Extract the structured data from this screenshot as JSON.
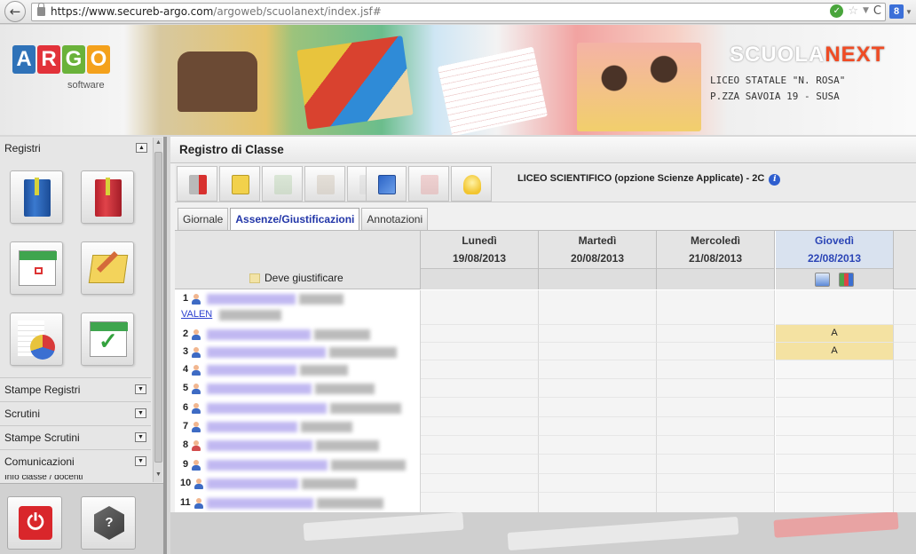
{
  "browser": {
    "url_main": "https://www.secureb-argo.com",
    "url_rest": "/argoweb/scuolanext/index.jsf#",
    "search_engine": "8"
  },
  "banner": {
    "logo_letters": [
      "A",
      "R",
      "G",
      "O"
    ],
    "logo_sub": "software",
    "product_name_a": "SCUOLA",
    "product_name_b": "NEXT",
    "school_name": "LICEO STATALE \"N. ROSA\"",
    "school_address": "P.ZZA SAVOIA 19 - SUSA"
  },
  "sidebar": {
    "section_title": "Registri",
    "tiles": [
      {
        "name": "registro-classe",
        "icon": "blue-book-icon"
      },
      {
        "name": "registro-professore",
        "icon": "red-book-icon"
      },
      {
        "name": "calendario",
        "icon": "calendar-icon"
      },
      {
        "name": "annotazioni",
        "icon": "notepad-pencil-icon"
      },
      {
        "name": "statistiche",
        "icon": "spreadsheet-pie-icon"
      },
      {
        "name": "appello",
        "icon": "calendar-check-icon"
      }
    ],
    "menu": [
      "Stampe Registri",
      "Scrutini",
      "Stampe Scrutini",
      "Comunicazioni"
    ],
    "partial_item": "Info classe / docenti",
    "bottom_buttons": [
      {
        "name": "logout",
        "icon": "power-icon"
      },
      {
        "name": "help",
        "icon": "help-cube-icon"
      }
    ]
  },
  "main": {
    "title": "Registro di Classe",
    "class_info": "LICEO SCIENTIFICO (opzione Scienze Applicate) - 2C",
    "toolbar_icons": [
      "exit-icon",
      "edit-note-icon",
      "check-disabled-icon",
      "pen-disabled-icon",
      "mail-disabled-icon",
      "copy-windows-icon",
      "red-disabled-icon",
      "lightbulb-icon"
    ],
    "tabs": [
      "Giornale",
      "Assenze/Giustificazioni",
      "Annotazioni"
    ],
    "active_tab": "Assenze/Giustificazioni",
    "legend": "Deve giustificare"
  },
  "days": [
    {
      "name": "Lunedì",
      "date": "19/08/2013",
      "today": false
    },
    {
      "name": "Martedì",
      "date": "20/08/2013",
      "today": false
    },
    {
      "name": "Mercoledì",
      "date": "21/08/2013",
      "today": false
    },
    {
      "name": "Giovedì",
      "date": "22/08/2013",
      "today": true
    }
  ],
  "students": [
    {
      "n": "1",
      "gender": "m",
      "extra": "VALEN",
      "marks": [
        "",
        "",
        "",
        ""
      ]
    },
    {
      "n": "2",
      "gender": "m",
      "marks": [
        "",
        "",
        "",
        "A"
      ]
    },
    {
      "n": "3",
      "gender": "m",
      "marks": [
        "",
        "",
        "",
        "A"
      ]
    },
    {
      "n": "4",
      "gender": "m",
      "marks": [
        "",
        "",
        "",
        ""
      ]
    },
    {
      "n": "5",
      "gender": "m",
      "marks": [
        "",
        "",
        "",
        ""
      ]
    },
    {
      "n": "6",
      "gender": "m",
      "marks": [
        "",
        "",
        "",
        ""
      ]
    },
    {
      "n": "7",
      "gender": "m",
      "marks": [
        "",
        "",
        "",
        ""
      ]
    },
    {
      "n": "8",
      "gender": "f",
      "marks": [
        "",
        "",
        "",
        ""
      ]
    },
    {
      "n": "9",
      "gender": "m",
      "marks": [
        "",
        "",
        "",
        ""
      ]
    },
    {
      "n": "10",
      "gender": "m",
      "marks": [
        "",
        "",
        "",
        ""
      ]
    },
    {
      "n": "11",
      "gender": "m",
      "marks": [
        "",
        "",
        "",
        ""
      ]
    }
  ],
  "colors": {
    "accent": "#2236a8",
    "absence": "#f4e2a2",
    "today_header": "#d9e2ef"
  }
}
